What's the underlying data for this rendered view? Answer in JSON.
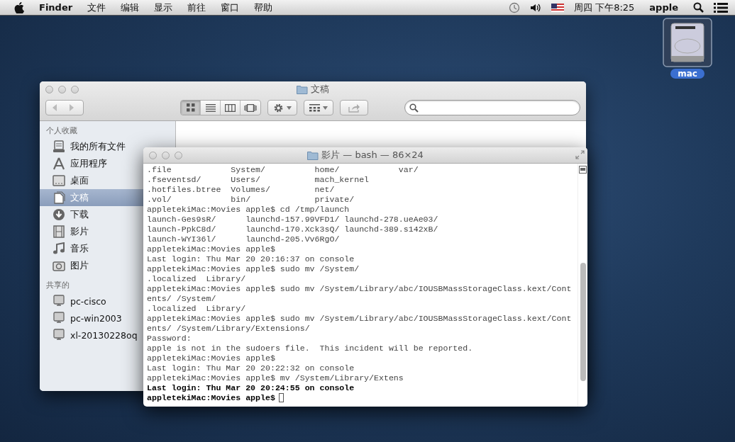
{
  "menu_bar": {
    "app_name": "Finder",
    "menus": [
      "文件",
      "编辑",
      "显示",
      "前往",
      "窗口",
      "帮助"
    ],
    "clock": "周四 下午8:25",
    "user": "apple"
  },
  "desktop_icons": [
    {
      "label": "mac",
      "selected": true
    }
  ],
  "finder_window": {
    "title": "文稿",
    "view_buttons": [
      {
        "kind": "icons",
        "selected": true
      },
      {
        "kind": "list",
        "selected": false
      },
      {
        "kind": "columns",
        "selected": false
      },
      {
        "kind": "coverflow",
        "selected": false
      }
    ],
    "sidebar": [
      {
        "heading": "个人收藏",
        "items": [
          {
            "label": "我的所有文件",
            "kind": "allfiles",
            "selected": false
          },
          {
            "label": "应用程序",
            "kind": "apps",
            "selected": false
          },
          {
            "label": "桌面",
            "kind": "desktop",
            "selected": false
          },
          {
            "label": "文稿",
            "kind": "documents",
            "selected": true
          },
          {
            "label": "下载",
            "kind": "downloads",
            "selected": false
          },
          {
            "label": "影片",
            "kind": "movies",
            "selected": false
          },
          {
            "label": "音乐",
            "kind": "music",
            "selected": false
          },
          {
            "label": "图片",
            "kind": "pictures",
            "selected": false
          }
        ]
      },
      {
        "heading": "共享的",
        "items": [
          {
            "label": "pc-cisco",
            "kind": "computer",
            "selected": false
          },
          {
            "label": "pc-win2003",
            "kind": "computer",
            "selected": false
          },
          {
            "label": "xl-20130228oq",
            "kind": "computer",
            "selected": false
          }
        ]
      }
    ]
  },
  "terminal_window": {
    "title": "影片 — bash — 86×24",
    "lines": [
      {
        "text": ".file            System/          home/            var/",
        "bold": false
      },
      {
        "text": ".fseventsd/      Users/           mach_kernel",
        "bold": false
      },
      {
        "text": ".hotfiles.btree  Volumes/         net/",
        "bold": false
      },
      {
        "text": ".vol/            bin/             private/",
        "bold": false
      },
      {
        "text": "appletekiMac:Movies apple$ cd /tmp/launch",
        "bold": false
      },
      {
        "text": "launch-Ges9sR/      launchd-157.99VFD1/ launchd-278.ueAe03/",
        "bold": false
      },
      {
        "text": "launch-PpkC8d/      launchd-170.Xck3sQ/ launchd-389.s142xB/",
        "bold": false
      },
      {
        "text": "launch-WYI36l/      launchd-205.Vv6RgO/",
        "bold": false
      },
      {
        "text": "appletekiMac:Movies apple$",
        "bold": false
      },
      {
        "text": "Last login: Thu Mar 20 20:16:37 on console",
        "bold": false
      },
      {
        "text": "appletekiMac:Movies apple$ sudo mv /System/",
        "bold": false
      },
      {
        "text": ".localized  Library/",
        "bold": false
      },
      {
        "text": "appletekiMac:Movies apple$ sudo mv /System/Library/abc/IOUSBMassStorageClass.kext/Cont",
        "bold": false
      },
      {
        "text": "ents/ /System/",
        "bold": false
      },
      {
        "text": ".localized  Library/",
        "bold": false
      },
      {
        "text": "appletekiMac:Movies apple$ sudo mv /System/Library/abc/IOUSBMassStorageClass.kext/Cont",
        "bold": false
      },
      {
        "text": "ents/ /System/Library/Extensions/",
        "bold": false
      },
      {
        "text": "Password:",
        "bold": false
      },
      {
        "text": "apple is not in the sudoers file.  This incident will be reported.",
        "bold": false
      },
      {
        "text": "appletekiMac:Movies apple$",
        "bold": false
      },
      {
        "text": "Last login: Thu Mar 20 20:22:32 on console",
        "bold": false
      },
      {
        "text": "appletekiMac:Movies apple$ mv /System/Library/Extens",
        "bold": false
      },
      {
        "text": "Last login: Thu Mar 20 20:24:55 on console",
        "bold": true
      },
      {
        "text": "appletekiMac:Movies apple$",
        "bold": true
      }
    ]
  }
}
